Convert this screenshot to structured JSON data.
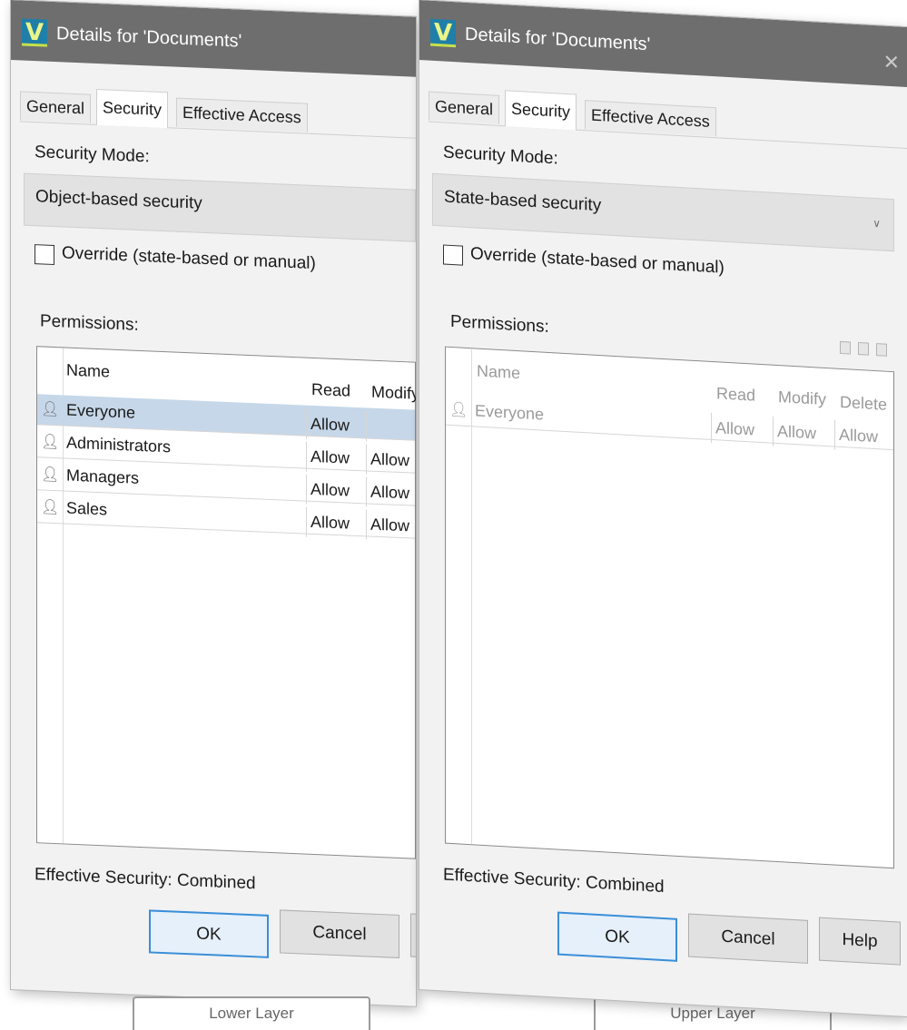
{
  "lower": {
    "title": "Details for 'Documents'",
    "tabs": [
      "General",
      "Security",
      "Effective Access"
    ],
    "security_mode_label": "Security Mode:",
    "security_mode_value": "Object-based security",
    "override_label": "Override (state-based or manual)",
    "permissions_label": "Permissions:",
    "columns": [
      "Name",
      "Read",
      "Modify"
    ],
    "rows": [
      {
        "name": "Everyone",
        "read": "Allow",
        "modify": ""
      },
      {
        "name": "Administrators",
        "read": "Allow",
        "modify": "Allow"
      },
      {
        "name": "Managers",
        "read": "Allow",
        "modify": "Allow"
      },
      {
        "name": "Sales",
        "read": "Allow",
        "modify": "Allow"
      }
    ],
    "effective_security": "Effective Security: Combined",
    "ok_label": "OK",
    "cancel_label": "Cancel"
  },
  "upper": {
    "title": "Details for 'Documents'",
    "tabs": [
      "General",
      "Security",
      "Effective Access"
    ],
    "security_mode_label": "Security Mode:",
    "security_mode_value": "State-based security",
    "override_label": "Override (state-based or manual)",
    "permissions_label": "Permissions:",
    "columns": [
      "Name",
      "Read",
      "Modify",
      "Delete"
    ],
    "rows": [
      {
        "name": "Everyone",
        "read": "Allow",
        "modify": "Allow",
        "delete": "Allow"
      }
    ],
    "effective_security": "Effective Security: Combined",
    "ok_label": "OK",
    "cancel_label": "Cancel",
    "help_label": "Help"
  },
  "captions": {
    "lower": "Lower Layer",
    "upper": "Upper Layer"
  },
  "colors": {
    "titlebar": "#6e6e6e",
    "selected_row": "#c6d7e9",
    "default_button_border": "#3a8ed8"
  }
}
